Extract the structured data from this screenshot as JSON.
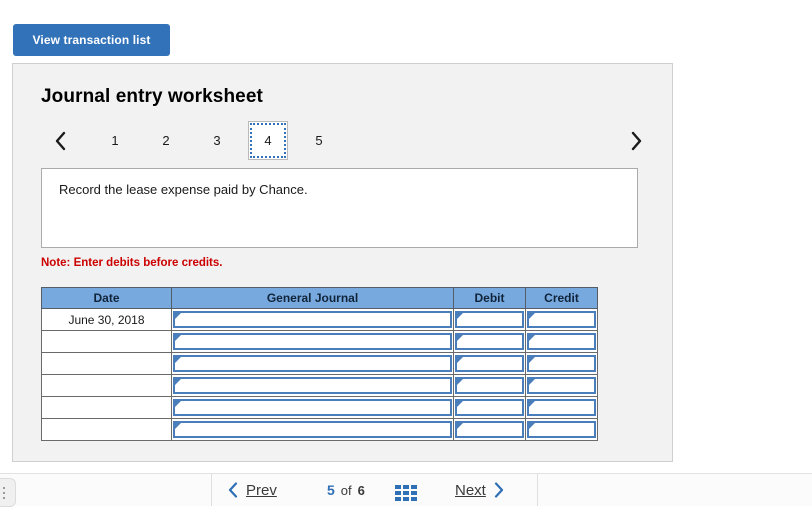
{
  "toolbar": {
    "view_transaction_list_label": "View transaction list"
  },
  "worksheet": {
    "title": "Journal entry worksheet",
    "tabs": [
      {
        "label": "1",
        "active": false
      },
      {
        "label": "2",
        "active": false
      },
      {
        "label": "3",
        "active": false
      },
      {
        "label": "4",
        "active": true
      },
      {
        "label": "5",
        "active": false
      }
    ],
    "instruction": "Record the lease expense paid by Chance.",
    "note": "Note: Enter debits before credits."
  },
  "journal_table": {
    "headers": [
      "Date",
      "General Journal",
      "Debit",
      "Credit"
    ],
    "rows": [
      {
        "date": "June 30, 2018",
        "general_journal": "",
        "debit": "",
        "credit": ""
      },
      {
        "date": "",
        "general_journal": "",
        "debit": "",
        "credit": ""
      },
      {
        "date": "",
        "general_journal": "",
        "debit": "",
        "credit": ""
      },
      {
        "date": "",
        "general_journal": "",
        "debit": "",
        "credit": ""
      },
      {
        "date": "",
        "general_journal": "",
        "debit": "",
        "credit": ""
      },
      {
        "date": "",
        "general_journal": "",
        "debit": "",
        "credit": ""
      }
    ]
  },
  "footer": {
    "prev_label": "Prev",
    "next_label": "Next",
    "current_page": "5",
    "of_label": "of",
    "total_pages": "6",
    "grid_icon": "grid-view-icon"
  },
  "colors": {
    "accent_blue": "#3272b9",
    "header_blue": "#78a9de",
    "note_red": "#cc0000",
    "panel_gray": "#f2f2f2"
  }
}
